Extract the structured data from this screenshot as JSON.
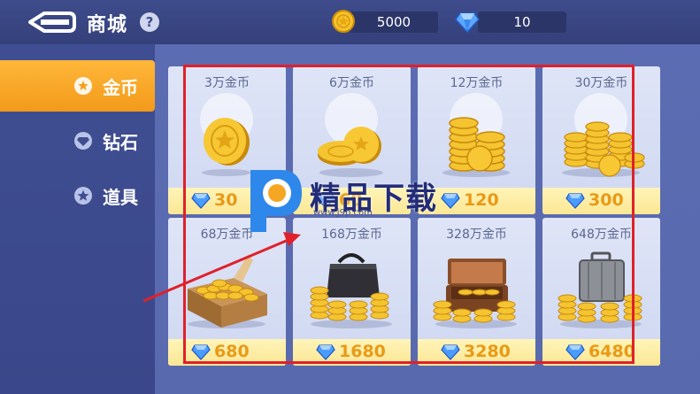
{
  "header": {
    "title": "商城",
    "help_label": "?"
  },
  "currencies": {
    "gold": "5000",
    "diamond": "10"
  },
  "sidebar": {
    "tabs": [
      {
        "label": "金币",
        "icon": "coin-tab-icon",
        "active": true
      },
      {
        "label": "钻石",
        "icon": "diamond-tab-icon",
        "active": false
      },
      {
        "label": "道具",
        "icon": "star-tab-icon",
        "active": false
      }
    ]
  },
  "products": [
    {
      "label": "3万金币",
      "price": "30",
      "art": "single-coin"
    },
    {
      "label": "6万金币",
      "price": "60",
      "art": "few-coins"
    },
    {
      "label": "12万金币",
      "price": "120",
      "art": "coin-stacks"
    },
    {
      "label": "30万金币",
      "price": "300",
      "art": "coin-pile"
    },
    {
      "label": "68万金币",
      "price": "680",
      "art": "coin-box"
    },
    {
      "label": "168万金币",
      "price": "1680",
      "art": "coin-bag"
    },
    {
      "label": "328万金币",
      "price": "3280",
      "art": "coin-chest"
    },
    {
      "label": "648万金币",
      "price": "6480",
      "art": "coin-suitcase"
    }
  ],
  "watermark": {
    "brand": "精品下载",
    "url": "www.j9p.com"
  },
  "colors": {
    "accent_orange": "#f5a623",
    "price_text": "#e99a16",
    "annotation_red": "#e0202a",
    "topbar": "#3e4c8c"
  }
}
